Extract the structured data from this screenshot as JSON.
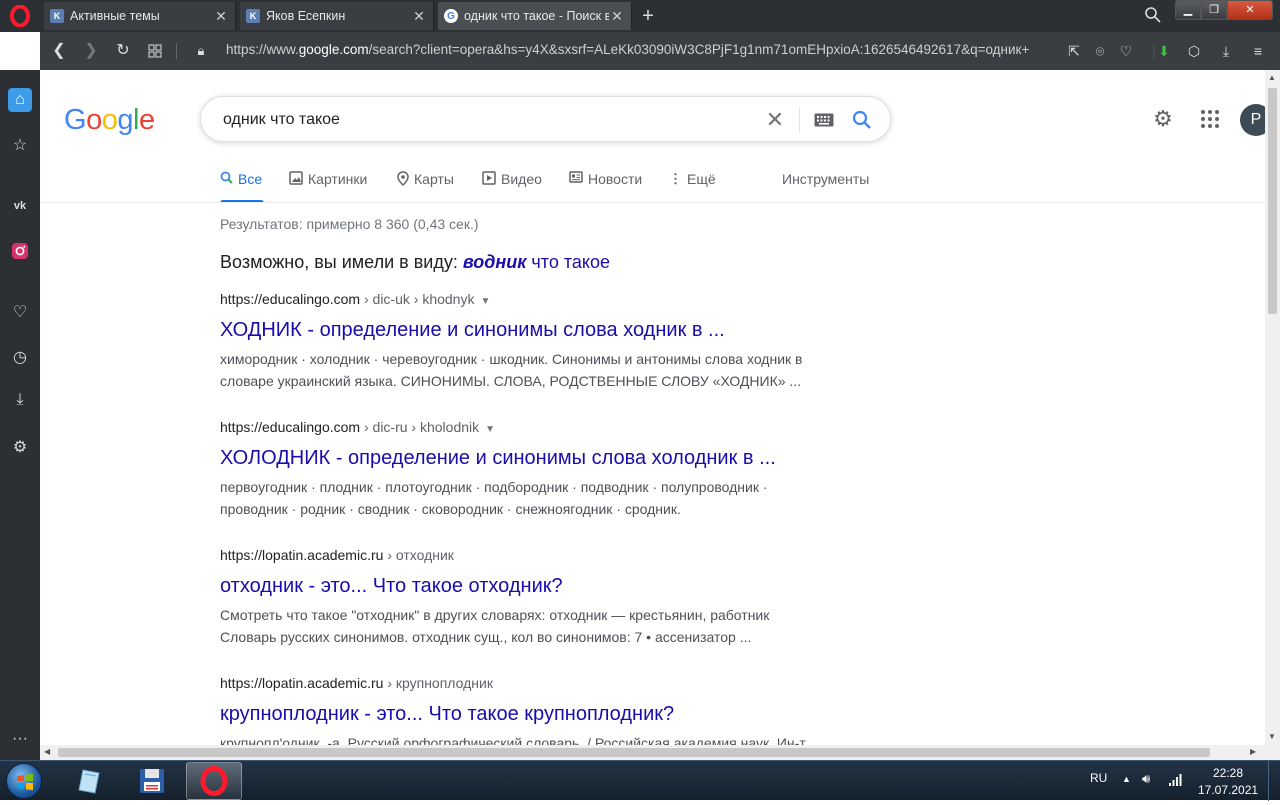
{
  "browser": {
    "tabs": [
      {
        "label": "Активные темы",
        "favicon": "vk-icon"
      },
      {
        "label": "Яков Есепкин",
        "favicon": "vk-icon"
      },
      {
        "label": "одник что такое - Поиск в",
        "favicon": "google-icon"
      }
    ],
    "url": {
      "prefix": "https://www.",
      "domain": "google.com",
      "rest": "/search?client=opera&hs=y4X&sxsrf=ALeKk03090iW3C8PjF1g1nm71omEHpxioA:1626546492617&q=одник+"
    }
  },
  "google": {
    "logo": [
      "G",
      "o",
      "o",
      "g",
      "l",
      "e"
    ],
    "logo_colors": [
      "#4285f4",
      "#ea4335",
      "#fbbc05",
      "#4285f4",
      "#34a853",
      "#ea4335"
    ],
    "query": "одник что такое",
    "avatar_letter": "Р",
    "tabs": [
      {
        "label": "Все",
        "icon": "search-icon"
      },
      {
        "label": "Картинки",
        "icon": "image-icon"
      },
      {
        "label": "Карты",
        "icon": "map-pin-icon"
      },
      {
        "label": "Видео",
        "icon": "video-icon"
      },
      {
        "label": "Новости",
        "icon": "news-icon"
      },
      {
        "label": "Ещё",
        "icon": "more-vertical-icon"
      },
      {
        "label": "Инструменты",
        "icon": ""
      }
    ],
    "stats": "Результатов: примерно 8 360 (0,43 сек.)",
    "did_you_mean": {
      "prefix": "Возможно, вы имели в виду:",
      "corrected_word": "водник",
      "rest": "что такое"
    },
    "results": [
      {
        "site": "https://educalingo.com",
        "crumbs": "› dic-uk › khodnyk",
        "title": "ХОДНИК - определение и синонимы слова ходник в ...",
        "snippet": "химородник · холодник · черевоугодник · шкодник. Синонимы и антонимы слова ходник в словаре украинский языка. СИНОНИМЫ. СЛОВА, РОДСТВЕННЫЕ СЛОВУ «ХОДНИК» ..."
      },
      {
        "site": "https://educalingo.com",
        "crumbs": "› dic-ru › kholodnik",
        "title": "ХОЛОДНИК - определение и синонимы слова холодник в ...",
        "snippet": "первоугодник · плодник · плотоугодник · подбородник · подводник · полупроводник · проводник · родник · сводник · сковородник · снежноягодник · сродник."
      },
      {
        "site": "https://lopatin.academic.ru",
        "crumbs": "› отходник",
        "title": "отходник - это... Что такое отходник?",
        "snippet": "Смотреть что такое \"отходник\" в других словарях: отходник — крестьянин, работник Словарь русских синонимов. отходник сущ., кол во синонимов: 7 • ассенизатор ..."
      },
      {
        "site": "https://lopatin.academic.ru",
        "crumbs": "› крупноплодник",
        "title": "крупноплодник - это... Что такое крупноплодник?",
        "snippet": "крупнопл'одник, -а. Русский орфографический словарь. / Российская академия наук. Ин-т"
      }
    ]
  },
  "taskbar": {
    "lang": "RU",
    "time": "22:28",
    "date": "17.07.2021"
  },
  "colors": {
    "link": "#1a0dab",
    "accent": "#1a73e8",
    "browser_dark": "#2c2f33"
  }
}
